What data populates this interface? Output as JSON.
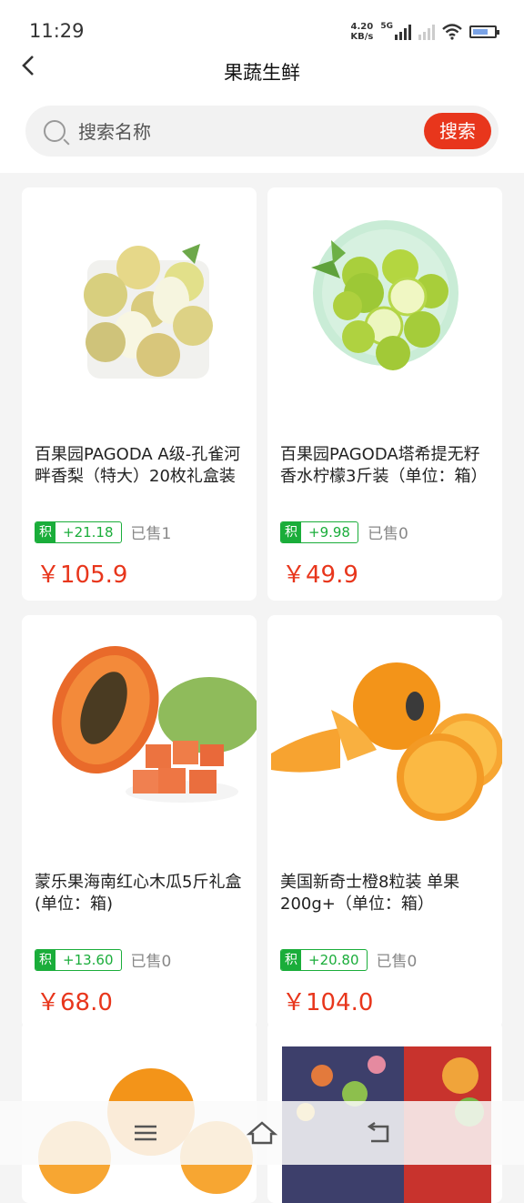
{
  "status": {
    "time": "11:29",
    "speed": "4.20",
    "speed_unit": "KB/s",
    "net": "5G"
  },
  "header": {
    "title": "果蔬生鲜"
  },
  "search": {
    "placeholder": "搜索名称",
    "button": "搜索"
  },
  "products": [
    {
      "name": "百果园PAGODA A级-孔雀河畔香梨（特大）20枚礼盒装",
      "points_label": "积",
      "points": "+21.18",
      "sold": "已售1",
      "price": "￥105.9"
    },
    {
      "name": "百果园PAGODA塔希提无籽香水柠檬3斤装（单位：箱）",
      "points_label": "积",
      "points": "+9.98",
      "sold": "已售0",
      "price": "￥49.9"
    },
    {
      "name": "蒙乐果海南红心木瓜5斤礼盒 (单位：箱)",
      "points_label": "积",
      "points": "+13.60",
      "sold": "已售0",
      "price": "￥68.0"
    },
    {
      "name": "美国新奇士橙8粒装  单果200g+（单位：箱）",
      "points_label": "积",
      "points": "+20.80",
      "sold": "已售0",
      "price": "￥104.0"
    }
  ],
  "icons": {
    "back": "back-arrow-icon",
    "search": "search-icon",
    "menu": "menu-icon",
    "home": "home-icon",
    "return": "return-icon"
  },
  "colors": {
    "accent": "#e8361c",
    "points": "#1aad3a"
  }
}
